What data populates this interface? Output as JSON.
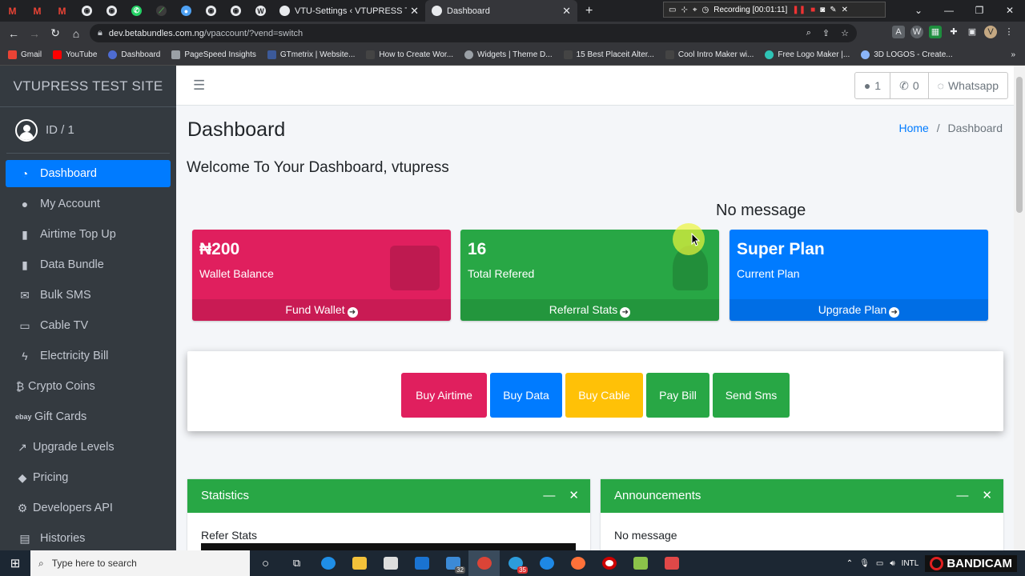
{
  "browser": {
    "pinned_tabs": [
      "M",
      "M",
      "M",
      "",
      "",
      "",
      "",
      "",
      "",
      ""
    ],
    "tabs": [
      {
        "title": "VTU-Settings ‹ VTUPRESS TEST S",
        "active": false
      },
      {
        "title": "Dashboard",
        "active": true
      }
    ],
    "recording": "Recording [00:01:11]",
    "url_host": "dev.betabundles.com.ng",
    "url_path": "/vpaccount/?vend=switch",
    "profile_initial": "V",
    "bookmarks": [
      "Gmail",
      "YouTube",
      "Dashboard",
      "PageSpeed Insights",
      "GTmetrix | Website...",
      "How to Create Wor...",
      "Widgets | Theme D...",
      "15 Best Placeit Alter...",
      "Cool Intro Maker wi...",
      "Free Logo Maker |...",
      "3D LOGOS - Create..."
    ]
  },
  "sidebar": {
    "brand": "VTUPRESS TEST SITE",
    "user": "ID / 1",
    "items": [
      {
        "label": "Dashboard",
        "icon": "dashboard-icon",
        "glyph": "◔",
        "active": true
      },
      {
        "label": "My Account",
        "icon": "user-icon",
        "glyph": "●",
        "active": false
      },
      {
        "label": "Airtime Top Up",
        "icon": "mobile-icon",
        "glyph": "▮",
        "active": false
      },
      {
        "label": "Data Bundle",
        "icon": "mobile-icon",
        "glyph": "▮",
        "active": false
      },
      {
        "label": "Bulk SMS",
        "icon": "envelope-icon",
        "glyph": "✉",
        "active": false
      },
      {
        "label": "Cable TV",
        "icon": "tv-icon",
        "glyph": "▭",
        "active": false
      },
      {
        "label": "Electricity Bill",
        "icon": "bolt-icon",
        "glyph": "ϟ",
        "active": false
      },
      {
        "label": "Crypto Coins",
        "icon": "bitcoin-icon",
        "glyph": "₿",
        "active": false
      },
      {
        "label": "Gift Cards",
        "icon": "ebay-icon",
        "glyph": "ebay",
        "active": false
      },
      {
        "label": "Upgrade Levels",
        "icon": "chart-line-icon",
        "glyph": "↗",
        "active": false
      },
      {
        "label": "Pricing",
        "icon": "tag-icon",
        "glyph": "◆",
        "active": false
      },
      {
        "label": "Developers API",
        "icon": "cogs-icon",
        "glyph": "⚙",
        "active": false
      },
      {
        "label": "Histories",
        "icon": "file-icon",
        "glyph": "▤",
        "active": false
      }
    ]
  },
  "topnav": {
    "user_count": "1",
    "phone_count": "0",
    "whatsapp": "Whatsapp"
  },
  "page": {
    "title": "Dashboard",
    "breadcrumb_home": "Home",
    "breadcrumb_sep": "/",
    "breadcrumb_current": "Dashboard",
    "welcome": "Welcome To Your Dashboard, vtupress",
    "message": "No message"
  },
  "boxes": [
    {
      "value": "₦200",
      "label": "Wallet Balance",
      "footer": "Fund Wallet",
      "color": "#e01f5e"
    },
    {
      "value": "16",
      "label": "Total Refered",
      "footer": "Referral Stats",
      "color": "#28a745"
    },
    {
      "value": "Super Plan",
      "label": "Current Plan",
      "footer": "Upgrade Plan",
      "color": "#007bff"
    }
  ],
  "quick_actions": [
    {
      "label": "Buy Airtime",
      "color": "#e01f5e"
    },
    {
      "label": "Buy Data",
      "color": "#007bff"
    },
    {
      "label": "Buy Cable",
      "color": "#ffc107"
    },
    {
      "label": "Pay Bill",
      "color": "#28a745"
    },
    {
      "label": "Send Sms",
      "color": "#28a745"
    }
  ],
  "cards": {
    "statistics": {
      "title": "Statistics",
      "body": "Refer Stats"
    },
    "announcements": {
      "title": "Announcements",
      "body": "No message"
    }
  },
  "taskbar": {
    "search_placeholder": "Type here to search",
    "badge_mail": "32",
    "badge_other": "35",
    "bandicam": "BANDICAM",
    "lang": "INTL"
  }
}
